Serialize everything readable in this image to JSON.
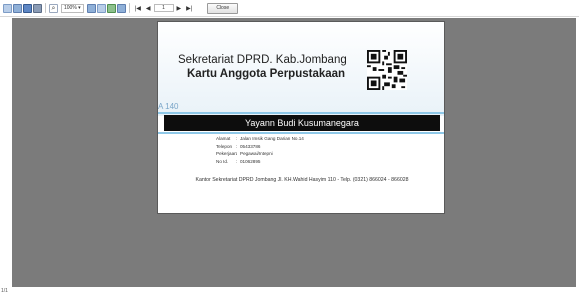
{
  "toolbar": {
    "icons": [
      "new-document-icon",
      "open-icon",
      "save-icon",
      "print-icon",
      "find-icon",
      "zoom-icon",
      "page-setup-icon",
      "export-icon",
      "email-icon",
      "first-page-icon",
      "previous-page-icon",
      "next-page-icon",
      "last-page-icon"
    ],
    "zoom_value": "100%",
    "page_value": "1",
    "close_label": "Close"
  },
  "card": {
    "organization": "Sekretariat DPRD. Kab.Jombang",
    "title": "Kartu Anggota Perpustakaan",
    "member_no": "A 140",
    "member_name": "Yayann Budi Kusumanegara",
    "details": [
      {
        "label": "Alamat",
        "value": "Jalan Imsik Gang Darian No.14"
      },
      {
        "label": "Telepon",
        "value": "05433786"
      },
      {
        "label": "Pekerjaan",
        "value": "Pegawai/Intepni"
      },
      {
        "label": "No Id.",
        "value": "01062895"
      }
    ],
    "footer": "Kantor Sekretariat DPRD Jombang Jl. KH.Wahid Hasyim 110 - Telp. (0321) 866024 - 866028"
  },
  "status": "1/1",
  "colors": {
    "viewer_background": "#7b7b7b",
    "name_bar": "#0d0d0d",
    "accent_line": "#8ec8e8",
    "member_no": "#7aa6c8"
  }
}
